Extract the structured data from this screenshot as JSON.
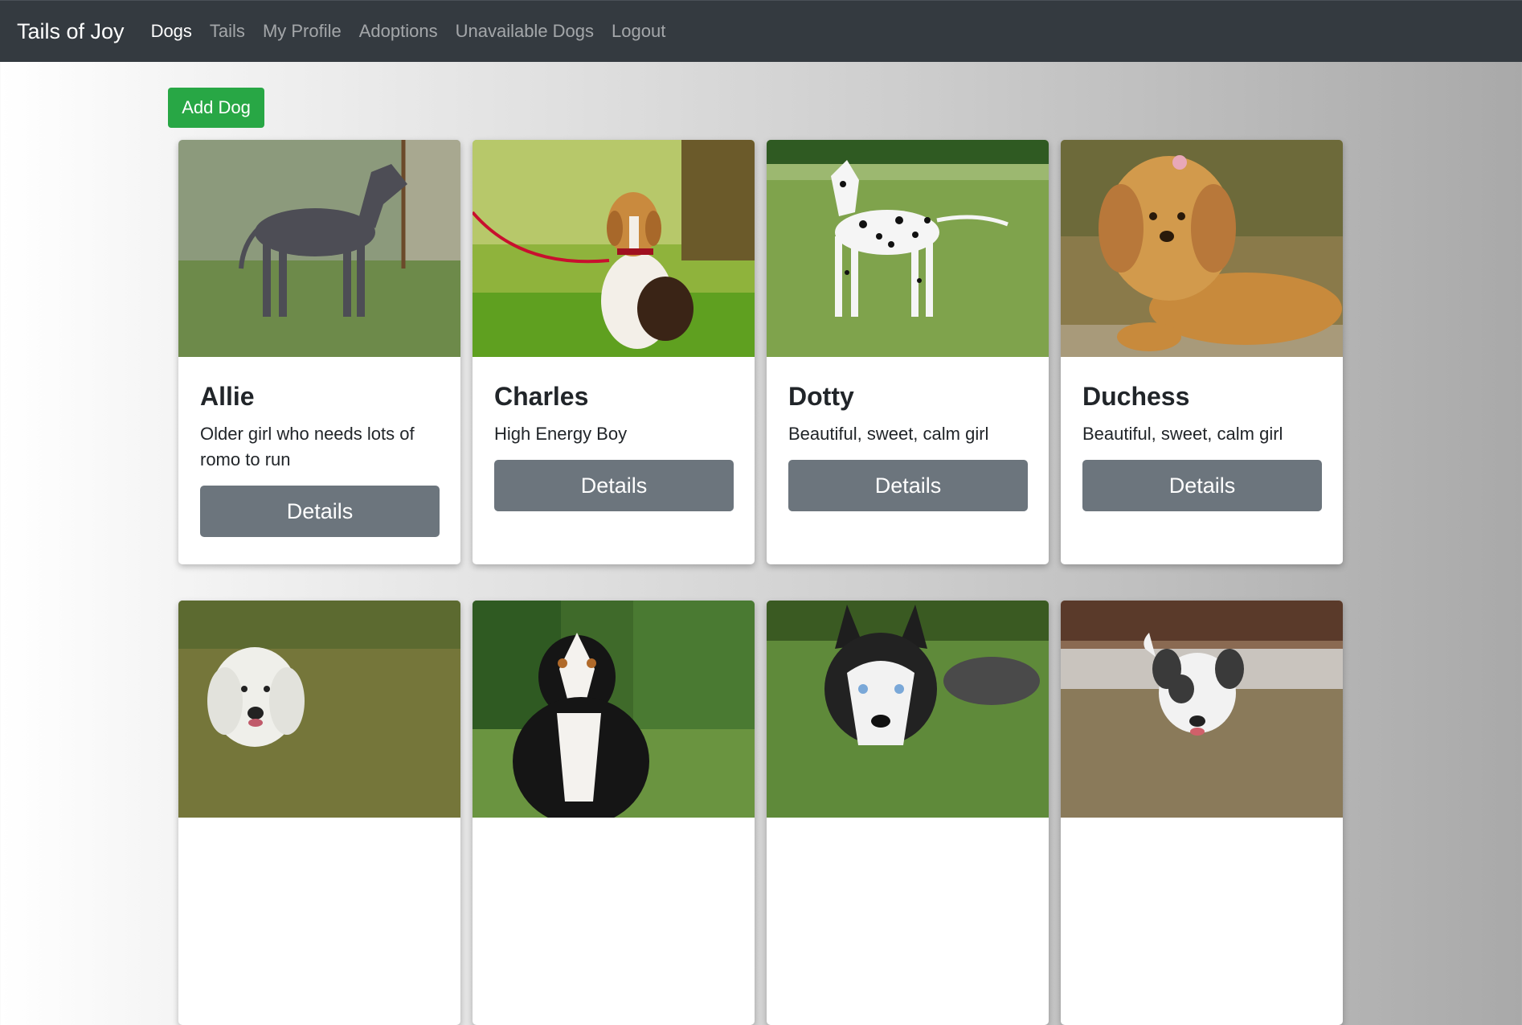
{
  "navbar": {
    "brand": "Tails of Joy",
    "links": [
      {
        "label": "Dogs",
        "active": true
      },
      {
        "label": "Tails",
        "active": false
      },
      {
        "label": "My Profile",
        "active": false
      },
      {
        "label": "Adoptions",
        "active": false
      },
      {
        "label": "Unavailable Dogs",
        "active": false
      },
      {
        "label": "Logout",
        "active": false
      }
    ]
  },
  "main": {
    "add_button_label": "Add Dog",
    "details_label": "Details",
    "dogs": [
      {
        "name": "Allie",
        "description": "Older girl who needs lots of romo to run"
      },
      {
        "name": "Charles",
        "description": "High Energy Boy"
      },
      {
        "name": "Dotty",
        "description": "Beautiful, sweet, calm girl"
      },
      {
        "name": "Duchess",
        "description": "Beautiful, sweet, calm girl"
      }
    ]
  },
  "colors": {
    "navbar": "#343a40",
    "success": "#28a745",
    "secondary": "#6c757d"
  }
}
